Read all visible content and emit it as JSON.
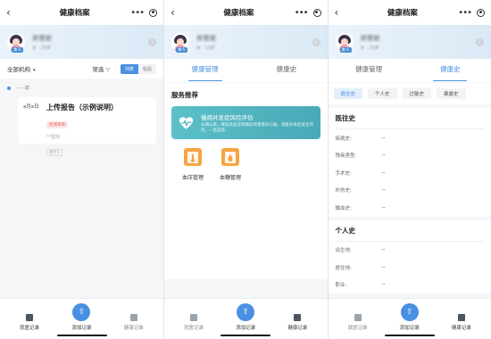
{
  "screens": [
    {
      "nav_title": "健康档案",
      "profile": {
        "name": "郑慧妮",
        "sub": "女 · 19岁",
        "tag": "本人"
      },
      "filter": {
        "institution": "全部机构",
        "filter_label": "筛选",
        "view_list": "列表",
        "view_grid": "粘贴"
      },
      "timeline": {
        "year": "·····年",
        "card": {
          "date": "x月x日",
          "title": "上传报告（示例说明）",
          "badge": "检测项目",
          "org": "**医院",
          "pic": "图片1"
        }
      }
    },
    {
      "nav_title": "健康档案",
      "profile": {
        "name": "郑慧妮",
        "sub": "女 · 19岁",
        "tag": "本人"
      },
      "tabs": [
        "健康管理",
        "健康史"
      ],
      "services_title": "服务推荐",
      "banner": {
        "title": "慢病并发症风险评估",
        "desc": "长期以来，降低高血压和糖尿病患者的心脑、肾脏并发症发生风险，一直是临..."
      },
      "tools": [
        "血压管理",
        "血糖管理"
      ]
    },
    {
      "nav_title": "健康档案",
      "profile": {
        "name": "郑慧妮",
        "sub": "女 · 19岁",
        "tag": "本人"
      },
      "tabs": [
        "健康管理",
        "健康史"
      ],
      "subtabs": [
        "既往史",
        "个人史",
        "过敏史",
        "暴露史"
      ],
      "past_history": {
        "title": "既往史",
        "rows": [
          {
            "k": "疾病史:",
            "v": "--"
          },
          {
            "k": "残疾类型:",
            "v": "--"
          },
          {
            "k": "手术史:",
            "v": "--"
          },
          {
            "k": "外伤史:",
            "v": "--"
          },
          {
            "k": "输血史:",
            "v": "--"
          }
        ]
      },
      "personal_history": {
        "title": "个人史",
        "rows": [
          {
            "k": "出生地:",
            "v": "--"
          },
          {
            "k": "居住地:",
            "v": "--"
          },
          {
            "k": "职业:",
            "v": "--"
          }
        ]
      }
    }
  ],
  "bottom_bar": [
    "就医记录",
    "添加记录",
    "健康记录"
  ],
  "icons": {
    "back": "chevron-left-icon",
    "more": "more-dots-icon",
    "close": "target-icon",
    "add": "upload-icon",
    "record": "notebook-icon",
    "health": "clipboard-icon",
    "blood_pressure": "thermometer-icon",
    "blood_sugar": "drop-icon"
  },
  "colors": {
    "accent": "#4a90e2",
    "banner": "#4aa9b8",
    "tool": "#f5a342",
    "badge": "#e05656"
  }
}
